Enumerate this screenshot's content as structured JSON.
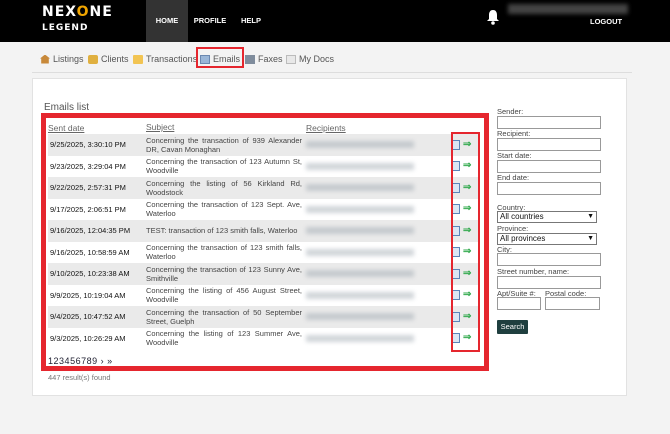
{
  "brand": {
    "logo_left": "NEX",
    "logo_accent": "O",
    "logo_right": "NE",
    "logo_sub": "LEGEND"
  },
  "top_nav": {
    "home": "HOME",
    "profile": "PROFILE",
    "help": "HELP",
    "logout": "LOGOUT"
  },
  "sub_nav": [
    {
      "label": "Listings",
      "icon": "house-icon"
    },
    {
      "label": "Clients",
      "icon": "clients-icon"
    },
    {
      "label": "Transactions",
      "icon": "folder-icon"
    },
    {
      "label": "Emails",
      "icon": "mail-icon"
    },
    {
      "label": "Faxes",
      "icon": "fax-icon"
    },
    {
      "label": "My Docs",
      "icon": "docs-icon"
    }
  ],
  "list": {
    "title": "Emails list",
    "columns": {
      "date": "Sent date",
      "subject": "Subject",
      "recipients": "Recipients"
    },
    "rows": [
      {
        "date": "9/25/2025, 3:30:10 PM",
        "subject": "Concerning the transaction of 939 Alexander DR, Cavan Monaghan"
      },
      {
        "date": "9/23/2025, 3:29:04 PM",
        "subject": "Concerning the transaction of 123 Autumn St, Woodville"
      },
      {
        "date": "9/22/2025, 2:57:31 PM",
        "subject": "Concerning the listing of 56 Kirkland Rd, Woodstock"
      },
      {
        "date": "9/17/2025, 2:06:51 PM",
        "subject": "Concerning the transaction of 123 Sept. Ave, Waterloo"
      },
      {
        "date": "9/16/2025, 12:04:35 PM",
        "subject": "TEST: transaction of 123 smith falls, Waterloo"
      },
      {
        "date": "9/16/2025, 10:58:59 AM",
        "subject": "Concerning the transaction of 123 smith falls, Waterloo"
      },
      {
        "date": "9/10/2025, 10:23:38 AM",
        "subject": "Concerning the transaction of 123 Sunny Ave, Smithville"
      },
      {
        "date": "9/9/2025, 10:19:04 AM",
        "subject": "Concerning the listing of 456 August Street, Woodville"
      },
      {
        "date": "9/4/2025, 10:47:52 AM",
        "subject": "Concerning the transaction of 50 September Street, Guelph"
      },
      {
        "date": "9/3/2025, 10:26:29 AM",
        "subject": "Concerning the listing of 123 Summer Ave, Woodville"
      }
    ],
    "pages": [
      "1",
      "2",
      "3",
      "4",
      "5",
      "6",
      "7",
      "8",
      "9"
    ],
    "next": "›",
    "last": "»",
    "results": "447 result(s) found"
  },
  "filters": {
    "sender": "Sender:",
    "recipient": "Recipient:",
    "start_date": "Start date:",
    "end_date": "End date:",
    "country": "Country:",
    "country_value": "All countries",
    "province": "Province:",
    "province_value": "All provinces",
    "city": "City:",
    "street": "Street number, name:",
    "apt": "Apt/Suite #:",
    "postal": "Postal code:",
    "search": "Search"
  },
  "colors": {
    "highlight": "#e5262e",
    "accent": "#f0a500",
    "action": "#2ea84a",
    "button": "#1f3f3f"
  }
}
